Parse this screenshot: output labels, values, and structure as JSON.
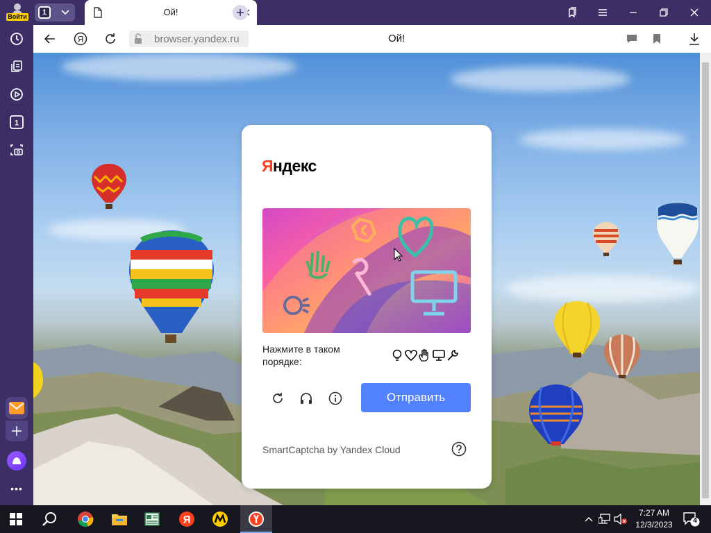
{
  "sidebar": {
    "login_label": "Войти",
    "items": [
      {
        "name": "history-icon"
      },
      {
        "name": "collections-icon"
      },
      {
        "name": "video-icon"
      },
      {
        "name": "tabs-count-icon",
        "label": "1"
      },
      {
        "name": "screenshot-icon"
      }
    ],
    "bottom": [
      "mail-icon",
      "add-icon",
      "alice-icon",
      "more-icon"
    ]
  },
  "tabbar": {
    "tab_count": "1",
    "active_tab_title": "Ой!",
    "window_buttons": [
      "bookmarks-icon",
      "menu-icon",
      "minimize-icon",
      "restore-icon",
      "close-icon"
    ]
  },
  "addressbar": {
    "url": "browser.yandex.ru",
    "page_title": "Ой!"
  },
  "captcha": {
    "logo_ya": "Я",
    "logo_rest": "ндекс",
    "instruction": "Нажмите в таком порядке:",
    "order_icons": [
      "lightbulb-icon",
      "heart-icon",
      "hand-icon",
      "monitor-icon",
      "wrench-icon"
    ],
    "submit_label": "Отправить",
    "footer": "SmartCaptcha by Yandex Cloud"
  },
  "taskbar": {
    "time": "7:27 AM",
    "date": "12/3/2023",
    "notification_count": "4",
    "apps": [
      "start-icon",
      "search-icon",
      "chrome-icon",
      "file-explorer-icon",
      "app-icon",
      "yandex-icon",
      "yandex-market-icon",
      "yandex-browser-icon"
    ]
  },
  "colors": {
    "sidebar_bg": "#3c2f66",
    "accent_blue": "#5282ff",
    "yandex_red": "#fc3f1d"
  }
}
